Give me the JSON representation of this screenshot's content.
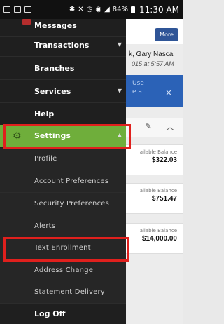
{
  "status_bar": {
    "battery": "84%",
    "time": "11:30 AM"
  },
  "header": {
    "more_label": "More"
  },
  "user": {
    "name_line": "k, Gary Nasca",
    "date_line": "015 at 5:57 AM"
  },
  "banner": {
    "text_line1": "Use",
    "text_line2": "e a",
    "close": "×"
  },
  "accounts": [
    {
      "label": "ailable Balance",
      "amount": "$322.03"
    },
    {
      "label": "ailable Balance",
      "amount": "$751.47"
    },
    {
      "label": "ailable Balance",
      "amount": "$14,000.00"
    }
  ],
  "menu": {
    "messages": "Messages",
    "transactions": "Transactions",
    "branches": "Branches",
    "services": "Services",
    "help": "Help",
    "settings": "Settings",
    "sub": {
      "profile": "Profile",
      "account_prefs": "Account Preferences",
      "security_prefs": "Security Preferences",
      "alerts": "Alerts",
      "text_enrollment": "Text Enrollment",
      "address_change": "Address Change",
      "statement_delivery": "Statement Delivery"
    },
    "log_off": "Log Off"
  },
  "colors": {
    "drawer_bg": "#1f1f1f",
    "settings_green": "#6fae3b",
    "highlight_red": "#e0201d",
    "accent_blue": "#2b62b7"
  }
}
